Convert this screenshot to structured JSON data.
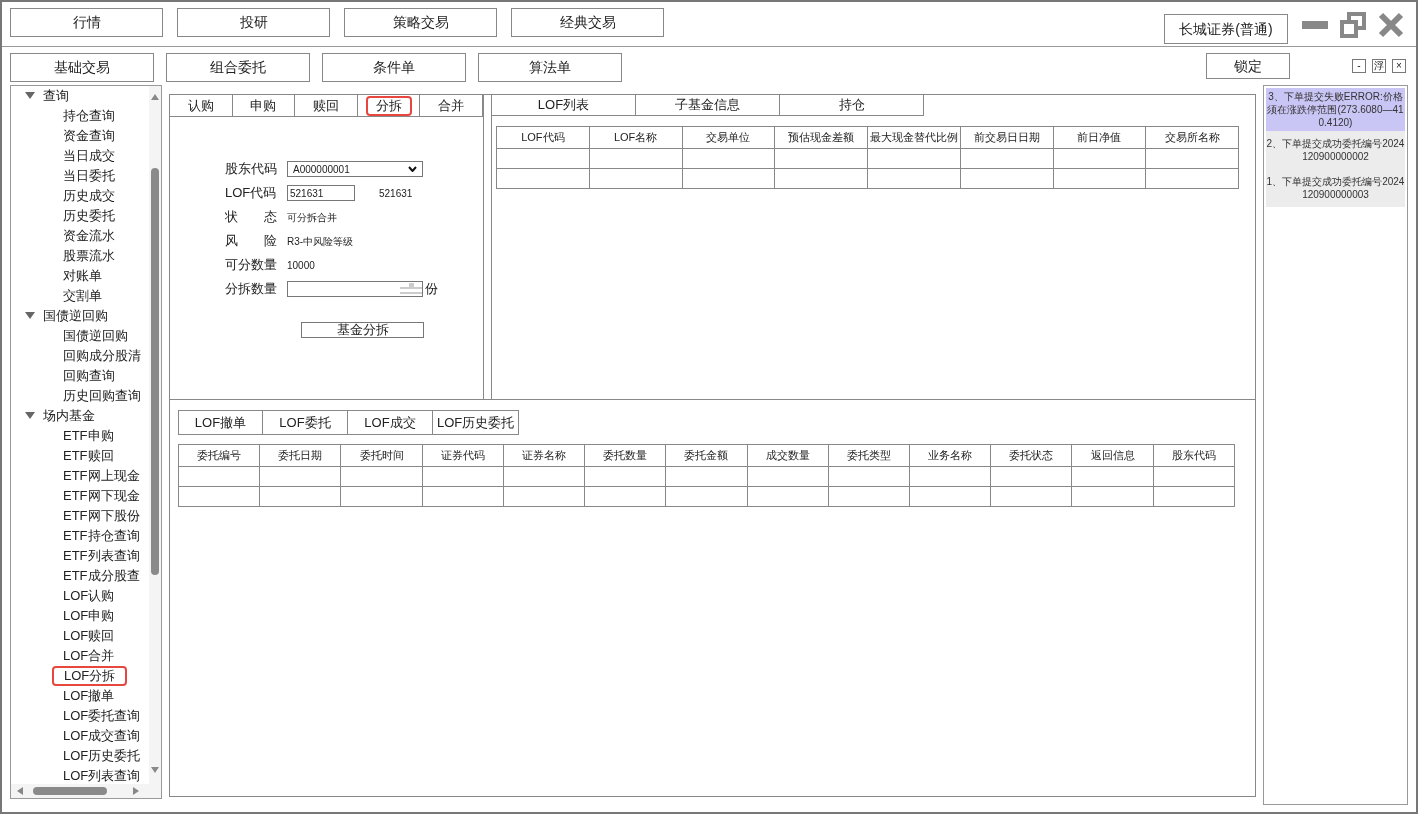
{
  "top_nav": [
    {
      "label": "行情"
    },
    {
      "label": "投研"
    },
    {
      "label": "策略交易"
    },
    {
      "label": "经典交易"
    }
  ],
  "broker_button": "长城证券(普通)",
  "sub_nav": [
    {
      "label": "基础交易"
    },
    {
      "label": "组合委托"
    },
    {
      "label": "条件单"
    },
    {
      "label": "算法单"
    }
  ],
  "lock_button": "锁定",
  "panel_controls": [
    "-",
    "浮",
    "×"
  ],
  "sidebar": {
    "items": [
      {
        "label": "查询",
        "expanded": true,
        "children": [
          {
            "label": "持仓查询",
            "selected": false
          },
          {
            "label": "资金查询",
            "selected": false
          },
          {
            "label": "当日成交",
            "selected": false
          },
          {
            "label": "当日委托",
            "selected": false
          },
          {
            "label": "历史成交",
            "selected": false
          },
          {
            "label": "历史委托",
            "selected": false
          },
          {
            "label": "资金流水",
            "selected": false
          },
          {
            "label": "股票流水",
            "selected": false
          },
          {
            "label": "对账单",
            "selected": false
          },
          {
            "label": "交割单",
            "selected": false
          }
        ]
      },
      {
        "label": "国债逆回购",
        "expanded": true,
        "children": [
          {
            "label": "国债逆回购",
            "selected": false
          },
          {
            "label": "回购成分股清",
            "selected": false
          },
          {
            "label": "回购查询",
            "selected": false
          },
          {
            "label": "历史回购查询",
            "selected": false
          }
        ]
      },
      {
        "label": "场内基金",
        "expanded": true,
        "children": [
          {
            "label": "ETF申购",
            "selected": false
          },
          {
            "label": "ETF赎回",
            "selected": false
          },
          {
            "label": "ETF网上现金",
            "selected": false
          },
          {
            "label": "ETF网下现金",
            "selected": false
          },
          {
            "label": "ETF网下股份",
            "selected": false
          },
          {
            "label": "ETF持仓查询",
            "selected": false
          },
          {
            "label": "ETF列表查询",
            "selected": false
          },
          {
            "label": "ETF成分股查",
            "selected": false
          },
          {
            "label": "LOF认购",
            "selected": false
          },
          {
            "label": "LOF申购",
            "selected": false
          },
          {
            "label": "LOF赎回",
            "selected": false
          },
          {
            "label": "LOF合并",
            "selected": false
          },
          {
            "label": "LOF分拆",
            "selected": true
          },
          {
            "label": "LOF撤单",
            "selected": false
          },
          {
            "label": "LOF委托查询",
            "selected": false
          },
          {
            "label": "LOF成交查询",
            "selected": false
          },
          {
            "label": "LOF历史委托",
            "selected": false
          },
          {
            "label": "LOF列表查询",
            "selected": false
          }
        ]
      }
    ]
  },
  "action_tabs": [
    {
      "label": "认购",
      "selected": false
    },
    {
      "label": "申购",
      "selected": false
    },
    {
      "label": "赎回",
      "selected": false
    },
    {
      "label": "分拆",
      "selected": true
    },
    {
      "label": "合并",
      "selected": false
    }
  ],
  "form": {
    "shareholder_code": {
      "label": "股东代码",
      "value": "A000000001"
    },
    "lof_code": {
      "label": "LOF代码",
      "value": "521631",
      "display": "521631"
    },
    "status": {
      "label": "状　　态",
      "value": "可分拆合并"
    },
    "risk": {
      "label": "风　　险",
      "value": "R3-中风险等级"
    },
    "available": {
      "label": "可分数量",
      "value": "10000"
    },
    "split_quantity": {
      "label": "分拆数量",
      "unit": "份"
    },
    "submit": "基金分拆"
  },
  "info_tabs": [
    {
      "label": "LOF列表"
    },
    {
      "label": "子基金信息"
    },
    {
      "label": "持仓"
    }
  ],
  "lof_table": {
    "columns": [
      "LOF代码",
      "LOF名称",
      "交易单位",
      "预估现金差额",
      "最大现金替代比例",
      "前交易日日期",
      "前日净值",
      "交易所名称"
    ]
  },
  "order_tabs": [
    {
      "label": "LOF撤单"
    },
    {
      "label": "LOF委托"
    },
    {
      "label": "LOF成交"
    },
    {
      "label": "LOF历史委托"
    }
  ],
  "order_table": {
    "columns": [
      "委托编号",
      "委托日期",
      "委托时间",
      "证券代码",
      "证券名称",
      "委托数量",
      "委托金额",
      "成交数量",
      "委托类型",
      "业务名称",
      "委托状态",
      "返回信息",
      "股东代码"
    ]
  },
  "messages": [
    {
      "kind": "error",
      "text": "3、下单提交失败ERROR:价格须在涨跌停范围(273.6080—410.4120)"
    },
    {
      "kind": "success",
      "text": "2、下单提交成功委托编号2024120900000002"
    },
    {
      "kind": "success",
      "text": "1、下单提交成功委托编号2024120900000003"
    }
  ]
}
